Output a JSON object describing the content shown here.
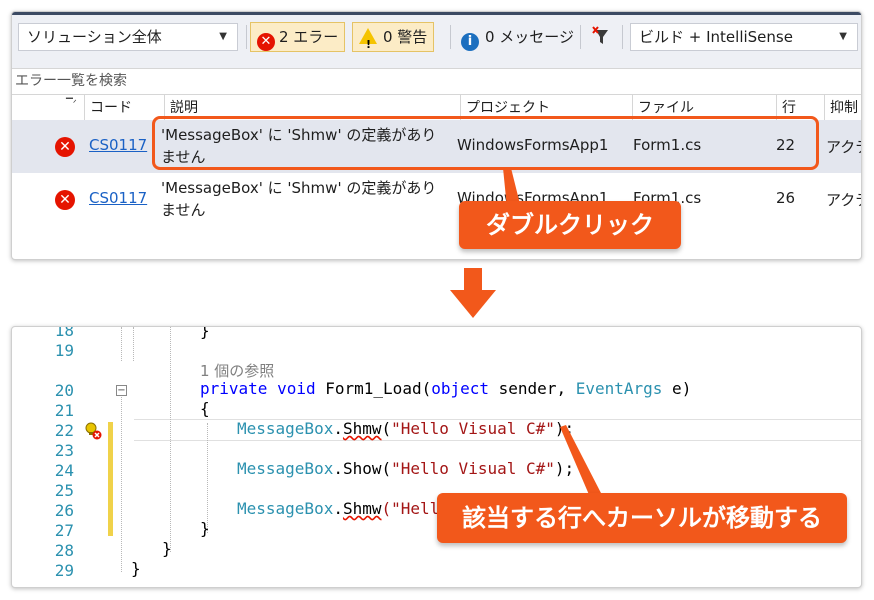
{
  "error_list": {
    "scope_filter": "ソリューション全体",
    "errors_btn": "2 エラー",
    "warnings_btn": "0 警告",
    "messages_btn": "0 メッセージ",
    "build_filter": "ビルド + IntelliSense",
    "search_placeholder": "エラー一覧を検索",
    "columns": {
      "code": "コード",
      "description": "説明",
      "project": "プロジェクト",
      "file": "ファイル",
      "line": "行",
      "suppression": "抑制"
    },
    "rows": [
      {
        "code": "CS0117",
        "description": "'MessageBox' に 'Shmw' の定義がありません",
        "project": "WindowsFormsApp1",
        "file": "Form1.cs",
        "line": "22",
        "suppression": "アクテ"
      },
      {
        "code": "CS0117",
        "description": "'MessageBox' に 'Shmw' の定義がありません",
        "project": "WindowsFormsApp1",
        "file": "Form1.cs",
        "line": "26",
        "suppression": "アクテ"
      }
    ]
  },
  "callouts": {
    "double_click": "ダブルクリック",
    "cursor_moves": "該当する行へカーソルが移動する"
  },
  "editor": {
    "line_numbers": [
      "18",
      "19",
      "20",
      "21",
      "22",
      "23",
      "24",
      "25",
      "26",
      "27",
      "28",
      "29"
    ],
    "codelens": "1 個の参照",
    "sig_private": "private",
    "sig_void": "void",
    "sig_method": "Form1_Load(",
    "sig_object": "object",
    "sig_sender": " sender, ",
    "sig_eventargs": "EventArgs",
    "sig_e": " e)",
    "brace_open": "{",
    "brace_close": "}",
    "line22_cls": "MessageBox",
    "line22_dot": ".",
    "line22_method": "Shmw",
    "line22_open": "(",
    "line22_str": "\"Hello Visual C#\"",
    "line22_close": ");",
    "line24_cls": "MessageBox",
    "line24_method": ".Show(",
    "line24_str": "\"Hello Visual C#\"",
    "line24_close": ");",
    "line26_cls": "MessageBox",
    "line26_dot": ".",
    "line26_method": "Shmw",
    "line26_rest": "(\"Hello"
  },
  "colors": {
    "accent": "#f2581b",
    "error": "#e51400",
    "keyword": "#0000ff",
    "type": "#2b91af",
    "string": "#a31515",
    "link": "#1a61c5"
  },
  "icons": [
    "error-icon",
    "warning-icon",
    "info-icon",
    "filter-icon",
    "lightbulb-icon",
    "down-arrow-icon",
    "collapse-icon"
  ]
}
